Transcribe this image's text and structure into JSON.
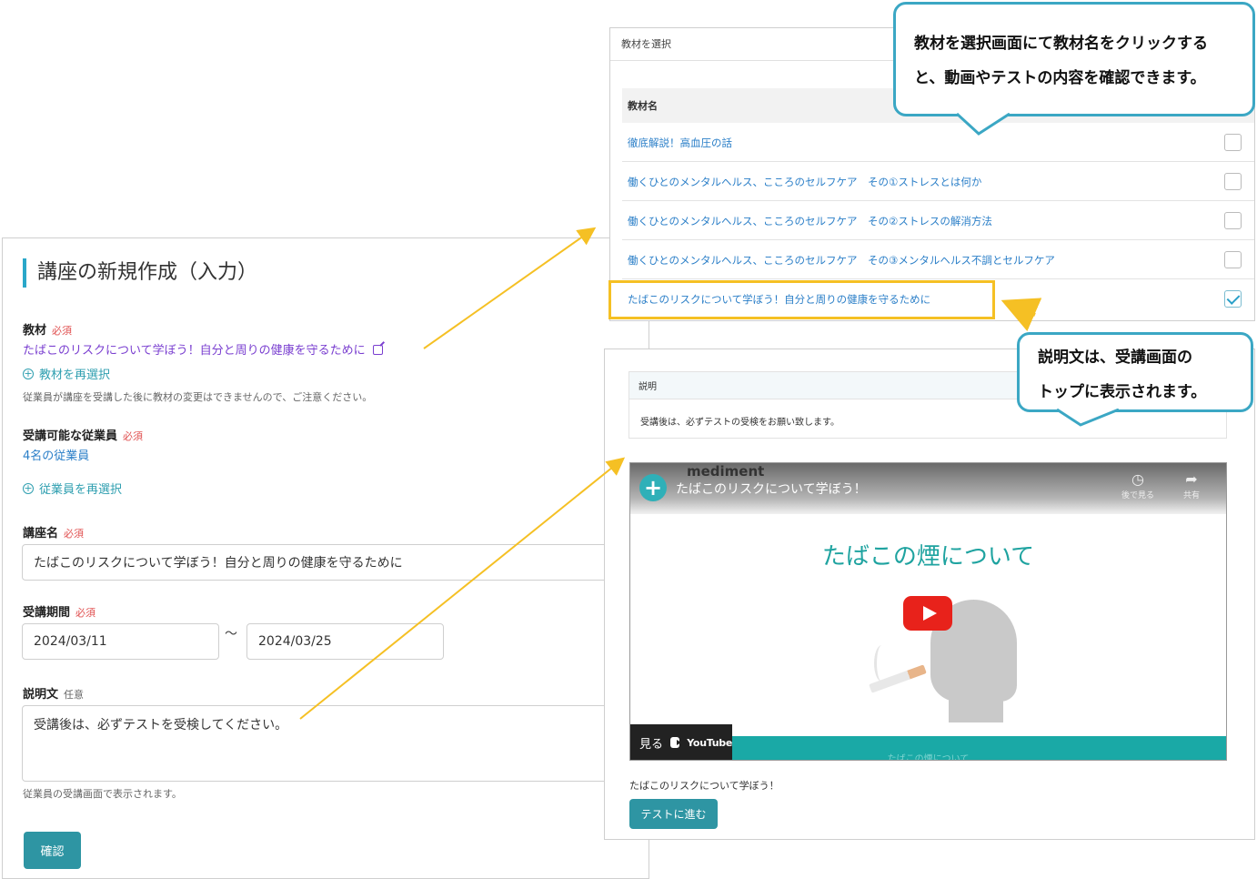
{
  "form": {
    "title": "講座の新規作成（入力）",
    "material_label": "教材",
    "required": "必須",
    "optional": "任意",
    "material_value": "たばこのリスクについて学ぼう！自分と周りの健康を守るために",
    "material_reselect": "教材を再選択",
    "material_note": "従業員が講座を受講した後に教材の変更はできませんので、ご注意ください。",
    "employees_label": "受講可能な従業員",
    "employees_value": "4名の従業員",
    "employees_reselect": "従業員を再選択",
    "course_name_label": "講座名",
    "course_name_value": "たばこのリスクについて学ぼう！自分と周りの健康を守るために",
    "period_label": "受講期間",
    "period_start": "2024/03/11",
    "period_sep": "〜",
    "period_end": "2024/03/25",
    "description_label": "説明文",
    "description_value": "受講後は、必ずテストを受検してください。",
    "description_note": "従業員の受講画面で表示されます。",
    "confirm_button": "確認"
  },
  "material_list": {
    "header": "教材を選択",
    "column_name": "教材名",
    "items": [
      {
        "name": "徹底解説！高血圧の話",
        "checked": false
      },
      {
        "name": "働くひとのメンタルヘルス、こころのセルフケア　その①ストレスとは何か",
        "checked": false
      },
      {
        "name": "働くひとのメンタルヘルス、こころのセルフケア　その②ストレスの解消方法",
        "checked": false
      },
      {
        "name": "働くひとのメンタルヘルス、こころのセルフケア　その③メンタルヘルス不調とセルフケア",
        "checked": false
      },
      {
        "name": "たばこのリスクについて学ぼう！自分と周りの健康を守るために",
        "checked": true
      }
    ]
  },
  "preview": {
    "desc_header": "説明",
    "desc_body": "受講後は、必ずテストの受検をお願い致します。",
    "video": {
      "brand": "mediment",
      "title": "たばこのリスクについて学ぼう！",
      "watch_later": "後で見る",
      "share": "共有",
      "main_title": "たばこの煙について",
      "watch_label": "見る",
      "youtube": "YouTube",
      "bar_text": "たばこの煙について"
    },
    "under_video": "たばこのリスクについて学ぼう！",
    "test_button": "テストに進む"
  },
  "callouts": {
    "top_line1": "教材を選択画面にて教材名をクリックする",
    "top_line2": "と、動画やテストの内容を確認できます。",
    "bottom_line1": "説明文は、受講画面の",
    "bottom_line2": "トップに表示されます。"
  },
  "colors": {
    "accent_teal": "#2e95a3",
    "highlight_yellow": "#f5c024",
    "callout_border": "#3ba7c4",
    "required_red": "#e05050"
  }
}
